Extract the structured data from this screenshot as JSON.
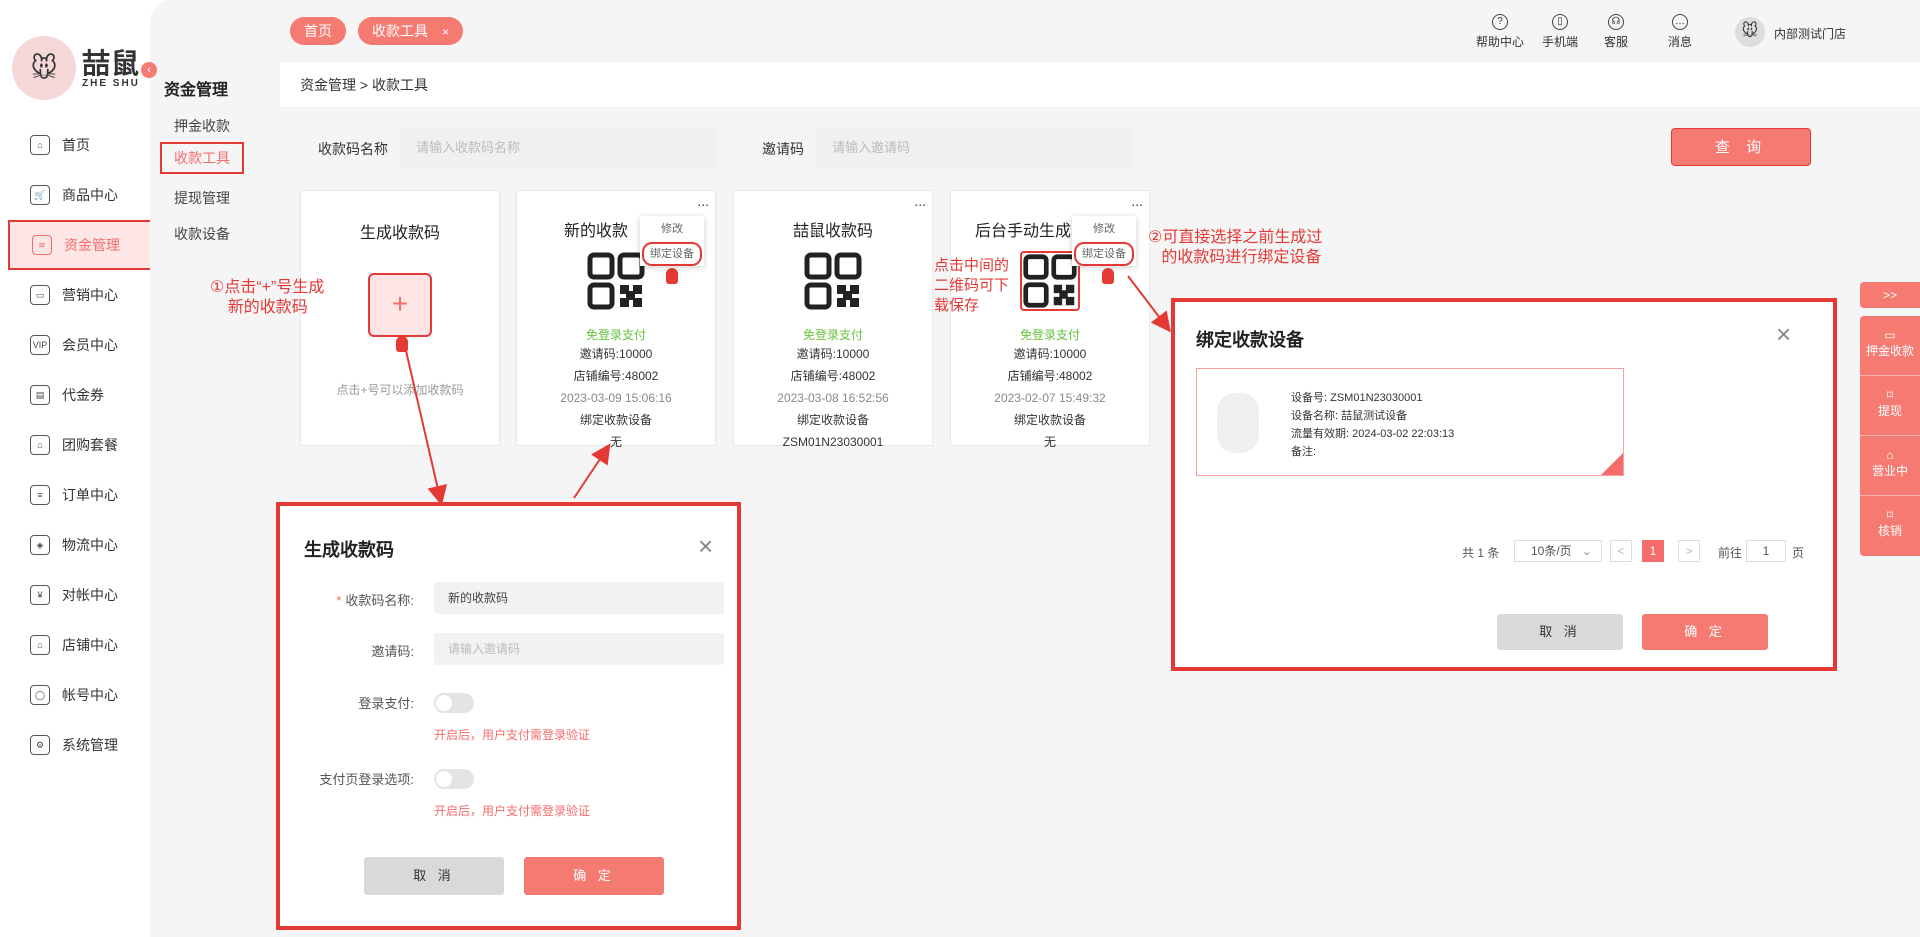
{
  "brand": {
    "zh": "喆鼠",
    "en": "ZHE SHU"
  },
  "nav": [
    {
      "label": "首页",
      "icon": "home-icon",
      "glyph": "⌂"
    },
    {
      "label": "商品中心",
      "icon": "cart-icon",
      "glyph": "🛒"
    },
    {
      "label": "资金管理",
      "icon": "layers-icon",
      "glyph": "≋",
      "active": true
    },
    {
      "label": "营销中心",
      "icon": "marketing-icon",
      "glyph": "▭"
    },
    {
      "label": "会员中心",
      "icon": "vip-card-icon",
      "glyph": "VIP"
    },
    {
      "label": "代金券",
      "icon": "coupon-icon",
      "glyph": "▤"
    },
    {
      "label": "团购套餐",
      "icon": "groupbuy-icon",
      "glyph": "⌂"
    },
    {
      "label": "订单中心",
      "icon": "order-icon",
      "glyph": "≡"
    },
    {
      "label": "物流中心",
      "icon": "box-icon",
      "glyph": "◈"
    },
    {
      "label": "对帐中心",
      "icon": "yuan-icon",
      "glyph": "¥"
    },
    {
      "label": "店铺中心",
      "icon": "shop-icon",
      "glyph": "⌂"
    },
    {
      "label": "帐号中心",
      "icon": "user-icon",
      "glyph": "◯"
    },
    {
      "label": "系统管理",
      "icon": "settings-icon",
      "glyph": "⚙"
    }
  ],
  "sub": {
    "title": "资金管理",
    "items": [
      "押金收款",
      "收款工具",
      "提现管理",
      "收款设备"
    ]
  },
  "tabs": [
    {
      "label": "首页"
    },
    {
      "label": "收款工具",
      "close": "×"
    }
  ],
  "toptools": [
    {
      "label": "帮助中心",
      "glyph": "?"
    },
    {
      "label": "手机端",
      "glyph": "▯"
    },
    {
      "label": "客服",
      "glyph": "☊"
    },
    {
      "label": "消息",
      "glyph": "…"
    }
  ],
  "shop": "内部测试门店",
  "breadcrumb": "资金管理 > 收款工具",
  "filter": {
    "name_label": "收款码名称",
    "name_placeholder": "请输入收款码名称",
    "code_label": "邀请码",
    "code_placeholder": "请输入邀请码",
    "query": "查 询"
  },
  "create_card": {
    "title": "生成收款码",
    "plus": "+",
    "hint": "点击+号可以添加收款码"
  },
  "cards": [
    {
      "title": "新的收款码",
      "title_shown": "新的收款",
      "free": "免登录支付",
      "invite": "邀请码:10000",
      "shop_no": "店铺编号:48002",
      "time": "2023-03-09 15:06:16",
      "bind_label": "绑定收款设备",
      "bind_value": "无"
    },
    {
      "title": "喆鼠收款码",
      "title_shown": "喆鼠收款码",
      "free": "免登录支付",
      "invite": "邀请码:10000",
      "shop_no": "店铺编号:48002",
      "time": "2023-03-08 16:52:56",
      "bind_label": "绑定收款设备",
      "bind_value": "ZSM01N23030001"
    },
    {
      "title": "后台手动生成",
      "title_shown": "后台手动生成",
      "free": "免登录支付",
      "invite": "邀请码:10000",
      "shop_no": "店铺编号:48002",
      "time": "2023-02-07 15:49:32",
      "bind_label": "绑定收款设备",
      "bind_value": "无"
    }
  ],
  "popmenu": {
    "edit": "修改",
    "bind": "绑定设备"
  },
  "dots": "...",
  "notes": {
    "n1": "①点击“+”号生成\n    新的收款码",
    "n2": "点击中间的\n二维码可下\n载保存",
    "n3": "②可直接选择之前生成过\n   的收款码进行绑定设备"
  },
  "create_dialog": {
    "title": "生成收款码",
    "close": "×",
    "name_label": "收款码名称:",
    "required": "*",
    "name_value": "新的收款码",
    "code_label": "邀请码:",
    "code_placeholder": "请输入邀请码",
    "login_label": "登录支付:",
    "login_hint": "开启后，用户支付需登录验证",
    "page_login_label": "支付页登录选项:",
    "page_login_hint": "开启后，用户支付需登录验证",
    "cancel": "取 消",
    "ok": "确 定"
  },
  "bind_dialog": {
    "title": "绑定收款设备",
    "close": "×",
    "device": {
      "no": "设备号: ZSM01N23030001",
      "name": "设备名称: 喆鼠测试设备",
      "valid": "流量有效期: 2024-03-02 22:03:13",
      "remark": "备注:"
    },
    "pagination": {
      "total": "共 1 条",
      "per_page": "10条/页",
      "prev": "<",
      "page": "1",
      "next": ">",
      "goto": "前往",
      "goto_value": "1",
      "page_unit": "页"
    },
    "cancel": "取 消",
    "ok": "确 定"
  },
  "rightbar": {
    "toggle": ">>",
    "items": [
      {
        "label": "押金收款",
        "glyph": "▭"
      },
      {
        "label": "提现",
        "glyph": "⌑"
      },
      {
        "label": "营业中",
        "glyph": "⌂"
      },
      {
        "label": "核销",
        "glyph": "⌑"
      }
    ]
  },
  "colors": {
    "accent": "#f57a72",
    "highlight": "#e53935",
    "success": "#67c23a"
  }
}
